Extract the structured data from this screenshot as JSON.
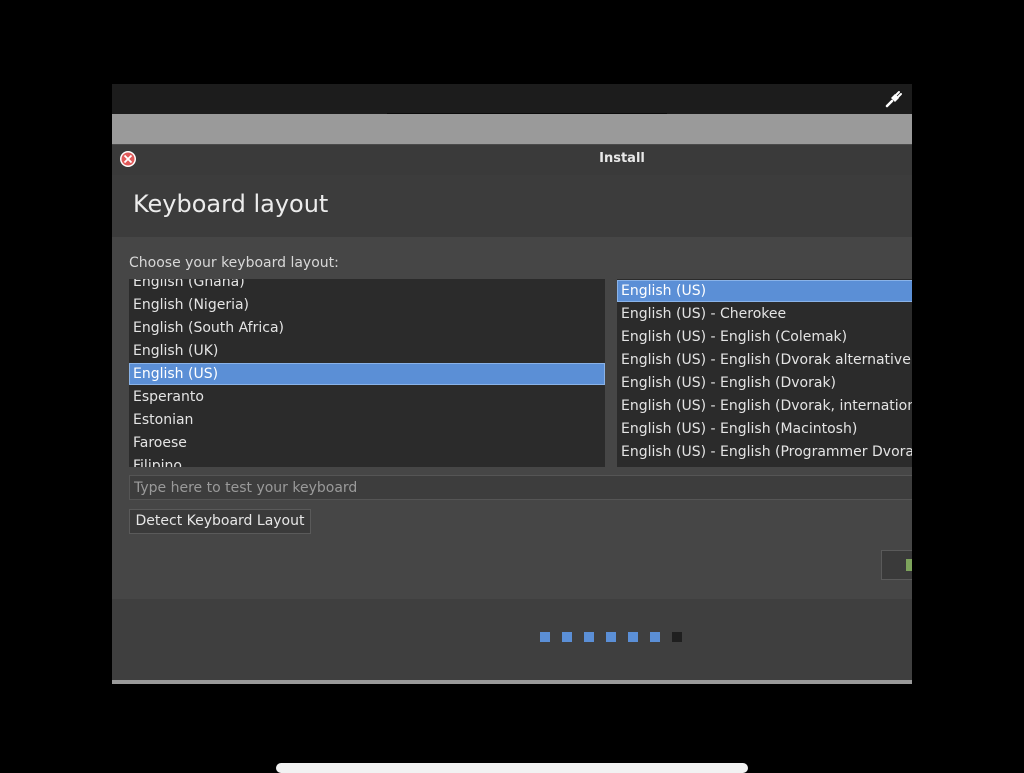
{
  "window": {
    "title": "Install"
  },
  "page": {
    "heading": "Keyboard layout",
    "prompt": "Choose your keyboard layout:"
  },
  "layouts": {
    "items": [
      {
        "label": "English (Ghana)",
        "selected": false
      },
      {
        "label": "English (Nigeria)",
        "selected": false
      },
      {
        "label": "English (South Africa)",
        "selected": false
      },
      {
        "label": "English (UK)",
        "selected": false
      },
      {
        "label": "English (US)",
        "selected": true
      },
      {
        "label": "Esperanto",
        "selected": false
      },
      {
        "label": "Estonian",
        "selected": false
      },
      {
        "label": "Faroese",
        "selected": false
      },
      {
        "label": "Filipino",
        "selected": false
      }
    ]
  },
  "variants": {
    "items": [
      {
        "label": "English (US)",
        "selected": true
      },
      {
        "label": "English (US) - Cherokee",
        "selected": false
      },
      {
        "label": "English (US) - English (Colemak)",
        "selected": false
      },
      {
        "label": "English (US) - English (Dvorak alternative in",
        "selected": false
      },
      {
        "label": "English (US) - English (Dvorak)",
        "selected": false
      },
      {
        "label": "English (US) - English (Dvorak, internationa",
        "selected": false
      },
      {
        "label": "English (US) - English (Macintosh)",
        "selected": false
      },
      {
        "label": "English (US) - English (Programmer Dvorak",
        "selected": false
      }
    ]
  },
  "test_field": {
    "value": "",
    "placeholder": "Type here to test your keyboard"
  },
  "detect_button": {
    "label": "Detect Keyboard Layout"
  },
  "progress": {
    "total_steps": 7,
    "completed_steps": 6
  },
  "colors": {
    "selection": "#5b8fd6",
    "step_done": "#5b8fd6",
    "step_pending": "#1f1f1f",
    "close_icon": "#e05a5a"
  }
}
